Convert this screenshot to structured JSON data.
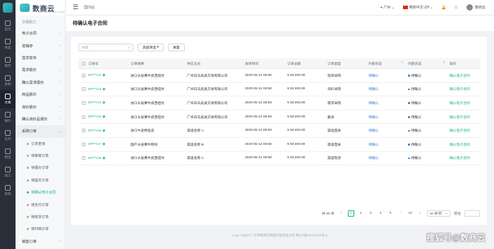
{
  "rail": {
    "items": [
      {
        "label": "首页",
        "icon": "home-icon"
      },
      {
        "label": "商品",
        "icon": "box-icon"
      },
      {
        "label": "库存",
        "icon": "stack-icon"
      },
      {
        "label": "采购",
        "icon": "cart-icon"
      },
      {
        "label": "文章",
        "icon": "document-icon"
      },
      {
        "label": "报价",
        "icon": "quote-icon"
      },
      {
        "label": "支付",
        "icon": "wallet-icon"
      },
      {
        "label": "物流",
        "icon": "truck-icon"
      },
      {
        "label": "加工",
        "icon": "tool-icon"
      },
      {
        "label": "系统",
        "icon": "gear-icon"
      }
    ],
    "active_index": 4
  },
  "brand": {
    "name": "数商云",
    "sub": "DATA COMMERCE CLOUD"
  },
  "menu": {
    "section": "交易助力",
    "items": [
      "电子合同",
      "进销存",
      "需求发布",
      "需求报价",
      "确认需求报价",
      "商品报价",
      "询价报价",
      "确认询价品报价"
    ],
    "open_group": "采购订单",
    "sub_items": [
      "订单查询",
      "待审核订单",
      "待报价订单",
      "待提交订单",
      "待确认电子合同",
      "待支付订单",
      "待收货订单",
      "待归档订单"
    ],
    "active_sub": 4,
    "last_item": "销售订单"
  },
  "topbar": {
    "breadcrumb": "国内站",
    "location": "广州",
    "language": "简体中文-ZH",
    "user": "数商云"
  },
  "page_title": "待确认电子合同",
  "filters": {
    "search_placeholder": "搜索",
    "advanced": "高级筛选",
    "reset": "重置"
  },
  "table": {
    "headers": [
      "订单号",
      "订单摘要",
      "供应业员",
      "发单时间",
      "订单总额",
      "订单类型",
      "外部状态",
      "内部状态",
      "操作"
    ],
    "rows": [
      {
        "no": "DPTY12",
        "name": "进口头层黄牛皮西桂纹",
        "sup": "广州白马皮具交易有限公司",
        "date": "2020-05-12 08:58",
        "amt": "¥ 50,000.00",
        "type": "现货采购",
        "ext": "待确认",
        "int": "待确认",
        "op": "确认电子合同"
      },
      {
        "no": "DPTY13",
        "name": "进口头层黄牛皮西桂纹",
        "sup": "广州白马皮具交易有限公司",
        "date": "2020-05-12 08:58",
        "amt": "¥ 50,000.00",
        "type": "询价采购",
        "ext": "待确认",
        "int": "待确认",
        "op": "确认电子合同"
      },
      {
        "no": "DPTY14",
        "name": "进口头层黄牛皮西桂纹",
        "sup": "广州白马皮具交易有限公司",
        "date": "2020-05-12 08:58",
        "amt": "¥ 50,000.00",
        "type": "需求采购",
        "ext": "待确认",
        "int": "待确认",
        "op": "确认电子合同"
      },
      {
        "no": "DPTY15",
        "name": "进口头层黄牛皮西桂纹",
        "sup": "广州白马皮具交易有限公司",
        "date": "2020-05-12 08:58",
        "amt": "¥ 50,000.00",
        "type": "集采",
        "ext": "待确认",
        "int": "待确认",
        "op": "确认电子合同"
      },
      {
        "no": "DPTY16",
        "name": "进口牛皮鳄鱼皮",
        "sup": "渠道名称 A",
        "date": "2020-05-12 08:58",
        "amt": "¥ 50,000.00",
        "type": "渠道直采",
        "ext": "待确认",
        "int": "待确认",
        "op": "确认电子合同"
      },
      {
        "no": "DPTY17",
        "name": "国产头层黄牛网纹",
        "sup": "渠道名称 B",
        "date": "2020-05-12 08:58",
        "amt": "¥ 50,000.00",
        "type": "渠道直采",
        "ext": "待确认",
        "int": "待确认",
        "op": "确认电子合同"
      },
      {
        "no": "DPTY18",
        "name": "进口头层黄牛皮西桂纹",
        "sup": "渠道名称 C",
        "date": "2020-05-12 08:58",
        "amt": "¥ 50,000.00",
        "type": "渠道现货",
        "ext": "待确认",
        "int": "待确认",
        "op": "确认电子合同"
      }
    ]
  },
  "pager": {
    "total": "共 80 条",
    "pages": [
      "1",
      "2",
      "3",
      "4",
      "5",
      "···",
      "10"
    ],
    "current": "1",
    "size": "10 条/页",
    "goto": "前往"
  },
  "footer": "Copy Right©广州市数商云网络科技有限公司 粤ICP备13044797号-5",
  "watermark": "搜狐号@数商云",
  "colors": {
    "accent": "#16b08a",
    "link": "#3a7bd5",
    "rail": "#2b2f3a"
  }
}
